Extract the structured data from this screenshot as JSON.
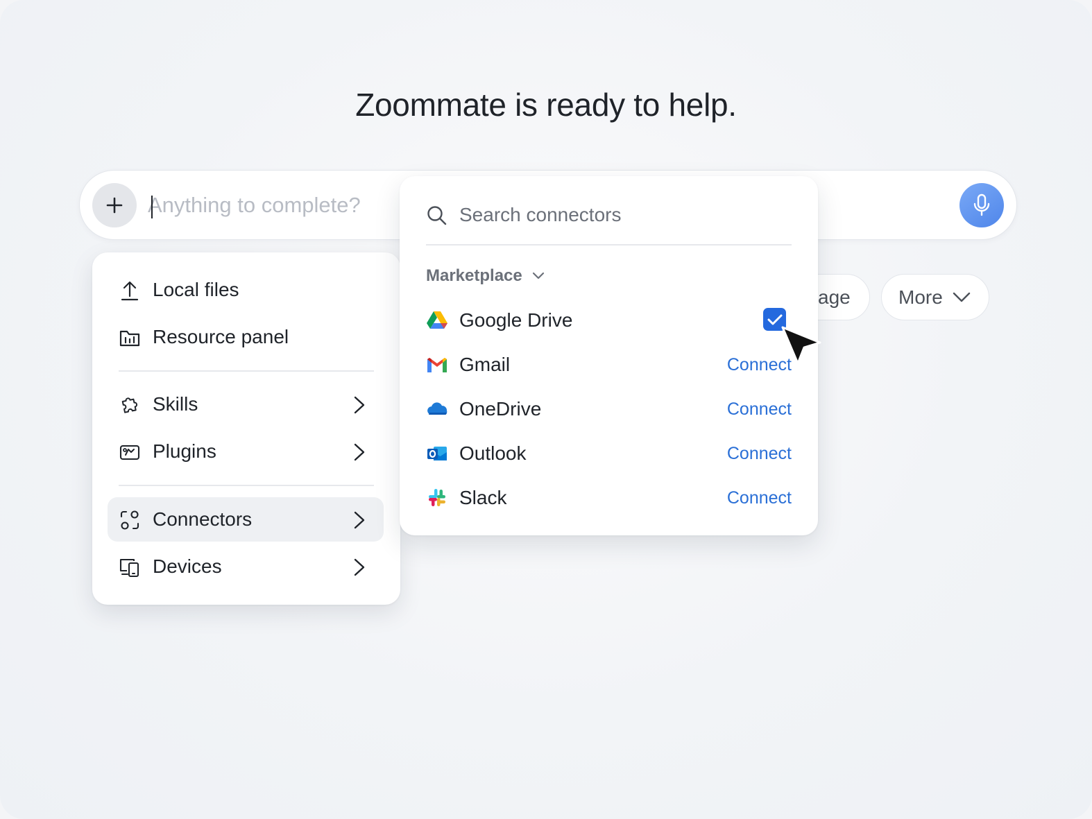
{
  "headline": "Zoommate is ready to help.",
  "prompt": {
    "placeholder": "Anything to complete?",
    "value": ""
  },
  "chips": {
    "image_partial": "age",
    "more_label": "More"
  },
  "menu": {
    "items": [
      {
        "label": "Local files",
        "icon": "upload-icon"
      },
      {
        "label": "Resource panel",
        "icon": "folder-icon"
      },
      {
        "label": "Skills",
        "icon": "puzzle-icon"
      },
      {
        "label": "Plugins",
        "icon": "plugin-icon"
      },
      {
        "label": "Connectors",
        "icon": "connectors-icon"
      },
      {
        "label": "Devices",
        "icon": "devices-icon"
      }
    ]
  },
  "connectors": {
    "search_placeholder": "Search connectors",
    "section": "Marketplace",
    "items": [
      {
        "name": "Google Drive",
        "state": "checked",
        "checked": true
      },
      {
        "name": "Gmail",
        "action": "Connect"
      },
      {
        "name": "OneDrive",
        "action": "Connect"
      },
      {
        "name": "Outlook",
        "action": "Connect"
      },
      {
        "name": "Slack",
        "action": "Connect"
      }
    ]
  },
  "colors": {
    "accent": "#2469de",
    "link": "#2a6fd6",
    "mic": "#5b8ff0"
  }
}
